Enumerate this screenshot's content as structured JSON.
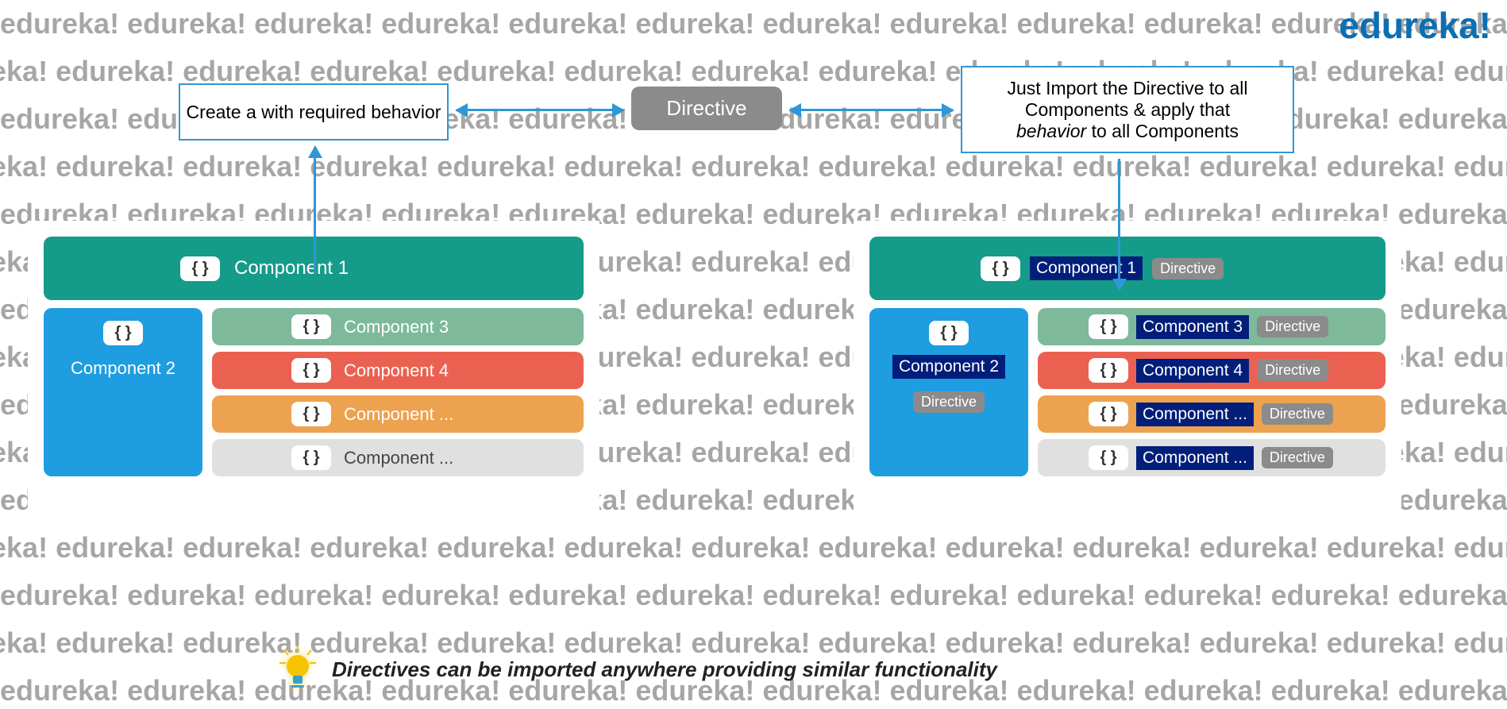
{
  "brand": "edureka!",
  "watermark_word": "edureka!",
  "top": {
    "create_label": "Create a with required behavior",
    "directive_label": "Directive",
    "import_line1": "Just Import the Directive to all",
    "import_line2": "Components & apply that",
    "import_line3_pre": "",
    "import_line3_italic": "behavior",
    "import_line3_post": " to all Components"
  },
  "left_panel": {
    "braces": "{ }",
    "comp1": "Component 1",
    "comp2": "Component 2",
    "comp3": "Component 3",
    "comp4": "Component 4",
    "comp5": "Component ...",
    "comp6": "Component ..."
  },
  "right_panel": {
    "braces": "{ }",
    "comp1": "Component 1",
    "comp2": "Component 2",
    "comp3": "Component 3",
    "comp4": "Component 4",
    "comp5": "Component ...",
    "comp6": "Component ...",
    "directive_badge": "Directive"
  },
  "footer_text": "Directives can be imported anywhere providing similar functionality"
}
